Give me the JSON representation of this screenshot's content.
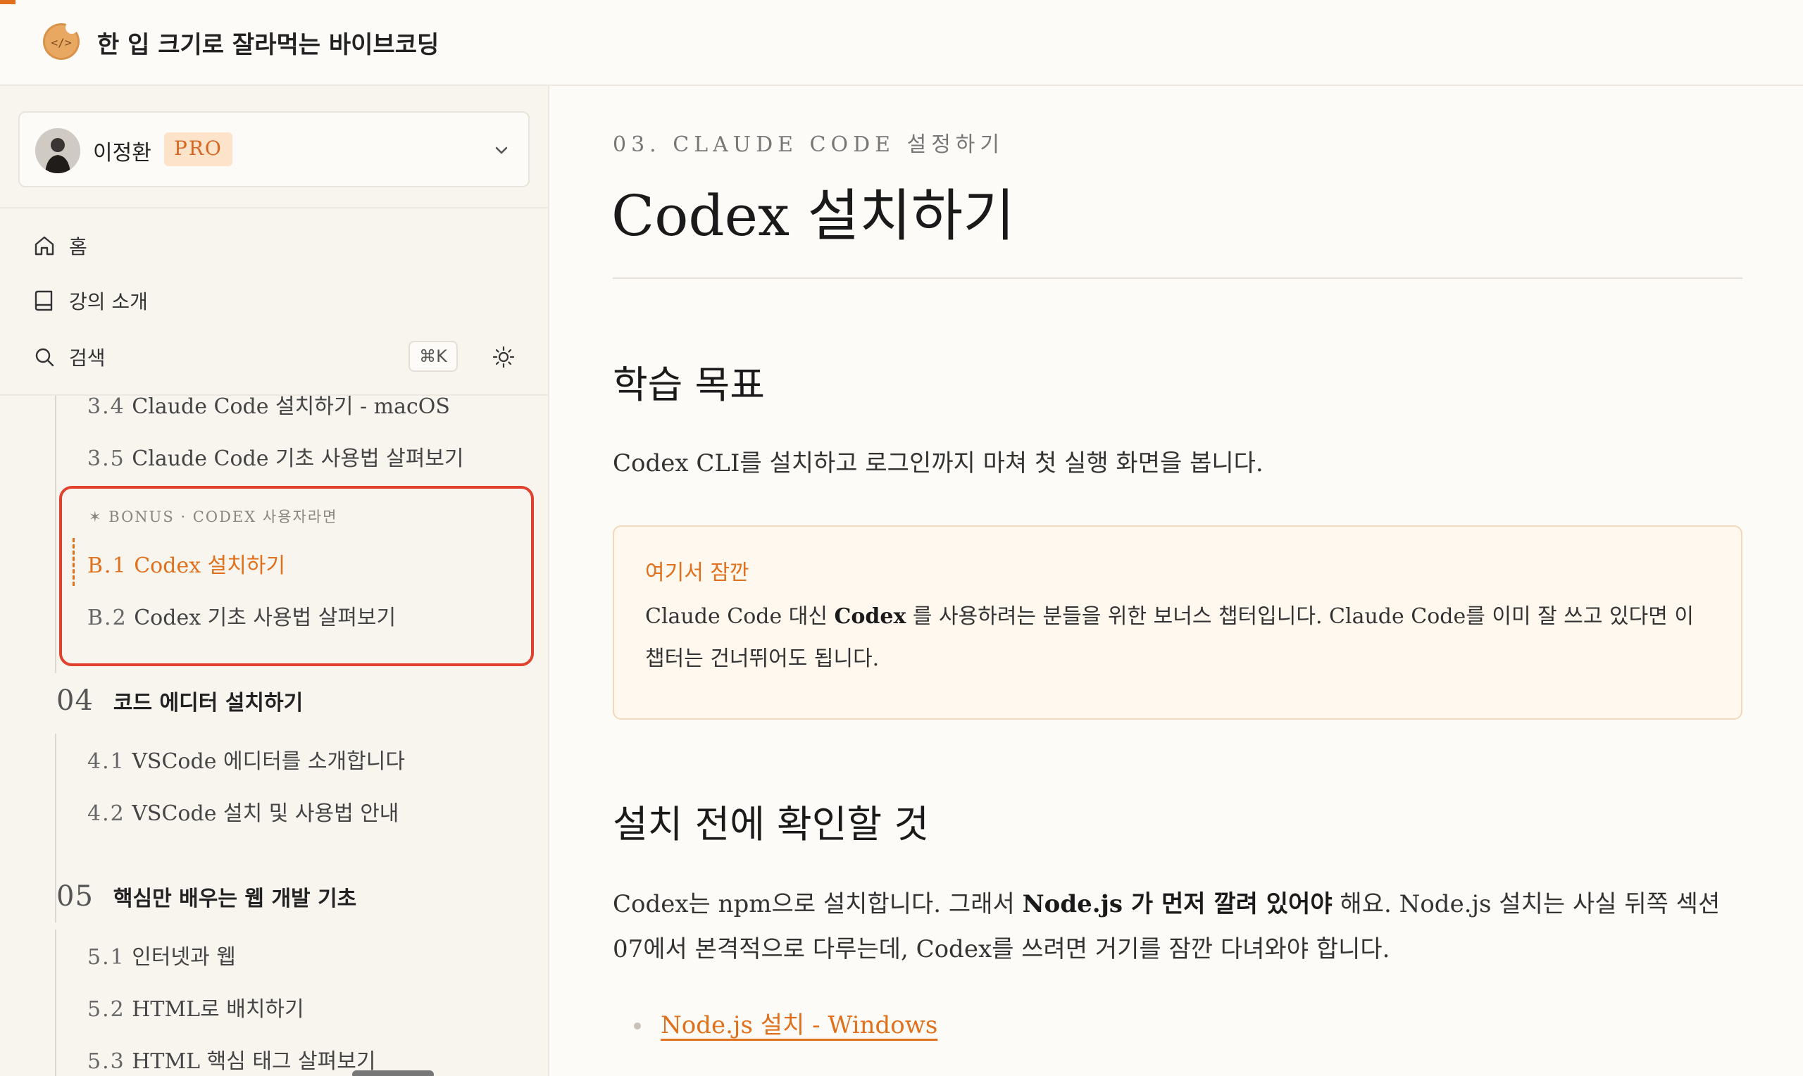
{
  "site": {
    "title": "한 입 크기로 잘라먹는 바이브코딩",
    "accent": "#e0701c"
  },
  "user": {
    "name": "이정환",
    "plan": "PRO"
  },
  "nav": {
    "home": "홈",
    "intro": "강의 소개",
    "search": "검색",
    "search_shortcut": "⌘K"
  },
  "toc": {
    "items_top": [
      {
        "num": "3.4",
        "label": "Claude Code 설치하기 - macOS"
      },
      {
        "num": "3.5",
        "label": "Claude Code 기초 사용법 살펴보기"
      }
    ],
    "bonus": {
      "label": "✶ BONUS · CODEX 사용자라면",
      "items": [
        {
          "num": "B.1",
          "label": "Codex 설치하기",
          "active": true
        },
        {
          "num": "B.2",
          "label": "Codex 기초 사용법 살펴보기"
        }
      ]
    },
    "sections": [
      {
        "num": "04",
        "title": "코드 에디터 설치하기",
        "items": [
          {
            "num": "4.1",
            "label": "VSCode 에디터를 소개합니다"
          },
          {
            "num": "4.2",
            "label": "VSCode 설치 및 사용법 안내"
          }
        ]
      },
      {
        "num": "05",
        "title": "핵심만 배우는 웹 개발 기초",
        "items": [
          {
            "num": "5.1",
            "label": "인터넷과 웹"
          },
          {
            "num": "5.2",
            "label": "HTML로 배치하기"
          },
          {
            "num": "5.3",
            "label": "HTML 핵심 태그 살펴보기"
          }
        ]
      }
    ]
  },
  "article": {
    "eyebrow": "03. CLAUDE CODE 설정하기",
    "title": "Codex 설치하기",
    "goal_heading": "학습 목표",
    "goal_text": "Codex CLI를 설치하고 로그인까지 마쳐 첫 실행 화면을 봅니다.",
    "callout": {
      "title": "여기서 잠깐",
      "body_pre": "Claude Code 대신 ",
      "body_bold": "Codex",
      "body_post": " 를 사용하려는 분들을 위한 보너스 챕터입니다. Claude Code를 이미 잘 쓰고 있다면 이 챕터는 건너뛰어도 됩니다."
    },
    "prereq_heading": "설치 전에 확인할 것",
    "prereq_pre": "Codex는 npm으로 설치합니다. 그래서 ",
    "prereq_bold": "Node.js 가 먼저 깔려 있어야",
    "prereq_post": " 해요. Node.js 설치는 사실 뒤쪽 섹션 07에서 본격적으로 다루는데, Codex를 쓰려면 거기를 잠깐 다녀와야 합니다.",
    "links": [
      "Node.js 설치 - Windows"
    ]
  }
}
